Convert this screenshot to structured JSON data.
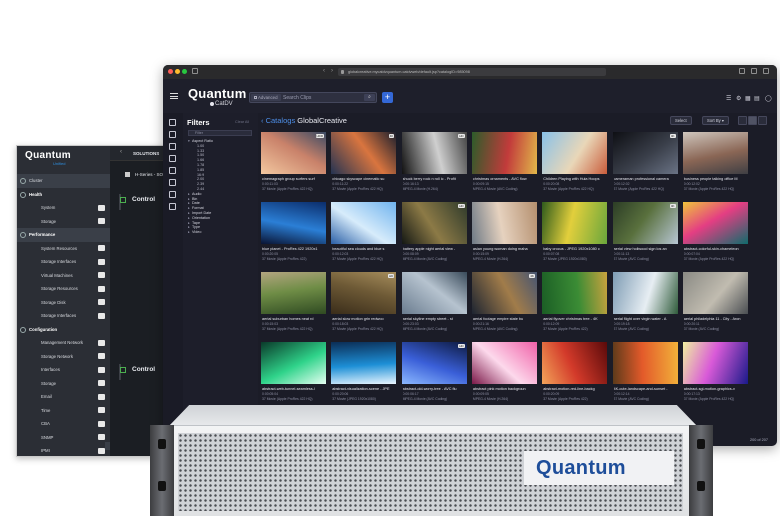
{
  "management": {
    "logo": "Quantum",
    "sublogo": "Unified",
    "nav": [
      {
        "label": "Cluster",
        "kind": "item",
        "active": true
      },
      {
        "label": "Health",
        "kind": "section"
      },
      {
        "label": "System",
        "kind": "sub"
      },
      {
        "label": "Storage",
        "kind": "sub"
      },
      {
        "label": "Performance",
        "kind": "section",
        "active": true
      },
      {
        "label": "System Resources",
        "kind": "sub"
      },
      {
        "label": "Storage Interfaces",
        "kind": "sub"
      },
      {
        "label": "Virtual Machines",
        "kind": "sub"
      },
      {
        "label": "Storage Resources",
        "kind": "sub"
      },
      {
        "label": "Storage Disk",
        "kind": "sub"
      },
      {
        "label": "Storage Interfaces",
        "kind": "sub"
      },
      {
        "label": "Configuration",
        "kind": "section"
      },
      {
        "label": "Management Network",
        "kind": "sub"
      },
      {
        "label": "Storage Network",
        "kind": "sub"
      },
      {
        "label": "Interfaces",
        "kind": "sub"
      },
      {
        "label": "Storage",
        "kind": "sub"
      },
      {
        "label": "Email",
        "kind": "sub"
      },
      {
        "label": "Time",
        "kind": "sub"
      },
      {
        "label": "CBA",
        "kind": "sub"
      },
      {
        "label": "SNMP",
        "kind": "sub"
      },
      {
        "label": "IPMI",
        "kind": "sub"
      }
    ],
    "bar_title": "SOLUTIONS",
    "series_label": "H-Series - SOL",
    "controls": [
      "Control",
      "Control"
    ]
  },
  "browser": {
    "url": "globalcreative.mycatdvquantum.catdvweb/default.jsp?catalogID=985098",
    "colors": {
      "close": "#ff5f57",
      "min": "#febc2e",
      "max": "#28c840"
    }
  },
  "catdv": {
    "logo": "Quantum",
    "logo_sub": "CatDV",
    "search": {
      "advanced_label": "Advanced",
      "placeholder": "Search Clips",
      "button": "⌕"
    },
    "add_label": "+",
    "filters": {
      "title": "Filters",
      "clear": "Clear All",
      "input_placeholder": "Filter",
      "tree": [
        {
          "label": "Aspect Ratio",
          "level": 1,
          "open": true
        },
        {
          "label": "1.00",
          "level": 2
        },
        {
          "label": "1.33",
          "level": 2
        },
        {
          "label": "1.50",
          "level": 2
        },
        {
          "label": "1.66",
          "level": 2
        },
        {
          "label": "1.78",
          "level": 2
        },
        {
          "label": "1.85",
          "level": 2
        },
        {
          "label": "16:9",
          "level": 2
        },
        {
          "label": "2.00",
          "level": 2
        },
        {
          "label": "2.39",
          "level": 2
        },
        {
          "label": "2.44",
          "level": 2
        },
        {
          "label": "Audio",
          "level": 1
        },
        {
          "label": "Bin",
          "level": 1
        },
        {
          "label": "Date",
          "level": 1
        },
        {
          "label": "Format",
          "level": 1
        },
        {
          "label": "Import Date",
          "level": 1
        },
        {
          "label": "Orientation",
          "level": 1
        },
        {
          "label": "Tape",
          "level": 1
        },
        {
          "label": "Type",
          "level": 1
        },
        {
          "label": "Video",
          "level": 1
        }
      ]
    },
    "catalog": {
      "prefix": "Catalogs",
      "name": "GlobalCreative"
    },
    "toolbar": {
      "select_label": "Select",
      "sort_label": "Sort By"
    },
    "footer": "200 of 207",
    "clips": [
      {
        "title": "cinemagraph group surfers surf",
        "dur": "0:00:11:03",
        "fmt": "37 Movie (Apple ProRes 422 HQ)",
        "colors": [
          "#f3c8a0",
          "#c9826a",
          "#3a4a63"
        ],
        "badge": "HDR"
      },
      {
        "title": "chicago skyscape cinematic su",
        "dur": "0:00:11:22",
        "fmt": "37 Movie (Apple ProRes 422 HQ)",
        "colors": [
          "#243352",
          "#d9753f",
          "#1b1f2d"
        ],
        "badge": "4K"
      },
      {
        "title": "shuck berry rock n roll ic - Profit",
        "dur": "0:00:16:13",
        "fmt": "MPEG-4 Movie (H.264)",
        "colors": [
          "#111111",
          "#cfcfcf",
          "#444444"
        ],
        "badge": "HD"
      },
      {
        "title": "christmas ornaments - AVC flow",
        "dur": "0:00:09:15",
        "fmt": "MPEG-4 Movie (AVC Coding)",
        "colors": [
          "#2c5c2a",
          "#c23b3b",
          "#e1b84a"
        ],
        "badge": ""
      },
      {
        "title": "Children Playing with Hula Hoops",
        "dur": "0:00:20:08",
        "fmt": "37 Movie (Apple ProRes 422 HQ)",
        "colors": [
          "#89c1e8",
          "#e9d7b8",
          "#c95c3b"
        ],
        "badge": ""
      },
      {
        "title": "cameraman professional camera",
        "dur": "0:00:12:02",
        "fmt": "37 Movie (Apple ProRes 422 HQ)",
        "colors": [
          "#0e0f14",
          "#3a3f4a",
          "#6a7385"
        ],
        "badge": "4K"
      },
      {
        "title": "business people talking office M",
        "dur": "0:00:12:02",
        "fmt": "37 Movie (Apple ProRes 422 HQ)",
        "colors": [
          "#cfc6bd",
          "#8a6655",
          "#3f3f44"
        ],
        "badge": ""
      },
      {
        "title": "blue planet - ProRes 422 1920x1",
        "dur": "0:00:20:05",
        "fmt": "37 Movie (Apple ProRes 422)",
        "colors": [
          "#0b2d6b",
          "#2b7fd6",
          "#0a1433"
        ],
        "badge": ""
      },
      {
        "title": "beautiful sea clouds and blue s",
        "dur": "0:00:12:03",
        "fmt": "37 Movie (Apple ProRes 422 HQ)",
        "colors": [
          "#6fb3ee",
          "#d7ecfb",
          "#2a5fa6"
        ],
        "badge": ""
      },
      {
        "title": "battery apple night aerial view -",
        "dur": "0:00:08:09",
        "fmt": "MPEG-4 Movie (AVC Coding)",
        "colors": [
          "#2e3a2b",
          "#8c7a46",
          "#141814"
        ],
        "badge": "HD"
      },
      {
        "title": "asian young woman doing maha",
        "dur": "0:00:15:09",
        "fmt": "MPEG-4 Movie (H.264)",
        "colors": [
          "#b48f6e",
          "#e6d2bf",
          "#6f7a86"
        ],
        "badge": ""
      },
      {
        "title": "baby crocus - JPEG 1920x1080 c",
        "dur": "0:00:07:08",
        "fmt": "37 Movie (JPEG 1920x1080)",
        "colors": [
          "#6aa63c",
          "#e2cf3c",
          "#2e5a1c"
        ],
        "badge": ""
      },
      {
        "title": "aerial view holiwood sign los an",
        "dur": "0:00:11:13",
        "fmt": "37 Movie (AVC Coding)",
        "colors": [
          "#b7c6d3",
          "#59703d",
          "#2c3d26"
        ],
        "badge": "4K"
      },
      {
        "title": "abstract-colorful-skin-chameleon",
        "dur": "0:00:07:04",
        "fmt": "37 Movie (Apple ProRes 422 HQ)",
        "colors": [
          "#0f6c6c",
          "#e43e83",
          "#f0c43b"
        ],
        "badge": ""
      },
      {
        "title": "aerial suburban homes neat rd",
        "dur": "0:00:15:03",
        "fmt": "37 Movie (Apple ProRes 422 HQ)",
        "colors": [
          "#2f4a22",
          "#6f8d46",
          "#b3a580"
        ],
        "badge": ""
      },
      {
        "title": "aerial slow motion grin redwoo",
        "dur": "0:00:18:03",
        "fmt": "37 Movie (Apple ProRes 422 HQ)",
        "colors": [
          "#3a2d1a",
          "#6e5a36",
          "#a68d5c"
        ],
        "badge": "HD"
      },
      {
        "title": "aerial skyline empty street - st",
        "dur": "0:00:23:03",
        "fmt": "MPEG-4 Movie (AVC Coding)",
        "colors": [
          "#6a7c8f",
          "#b6c3cf",
          "#394a5a"
        ],
        "badge": ""
      },
      {
        "title": "aerial footage empire state bu",
        "dur": "0:00:21:16",
        "fmt": "MPEG-4 Movie (AVC Coding)",
        "colors": [
          "#1d2431",
          "#a17c4a",
          "#465572"
        ],
        "badge": "4K"
      },
      {
        "title": "aerial flyover christmas tree - 4K",
        "dur": "0:00:12:09",
        "fmt": "37 Movie (Apple ProRes 422)",
        "colors": [
          "#1b5e25",
          "#3b8c35",
          "#c9a23e"
        ],
        "badge": ""
      },
      {
        "title": "aerial flight over virgin water - A",
        "dur": "0:00:19:18",
        "fmt": "37 Movie (AVC Coding)",
        "colors": [
          "#7e9cb4",
          "#e7eef3",
          "#2f5b3a"
        ],
        "badge": ""
      },
      {
        "title": "aerial philadelphia 11 - City - Aron",
        "dur": "0:00:20:11",
        "fmt": "37 Movie (AVC Coding)",
        "colors": [
          "#8a8a84",
          "#c1bcb0",
          "#4a4e52"
        ],
        "badge": ""
      },
      {
        "title": "abstract-web-tunnel-seamless-l",
        "dur": "0:00:05:04",
        "fmt": "37 Movie (Apple ProRes 422 HQ)",
        "colors": [
          "#0a3a2a",
          "#2fd38a",
          "#e6fff2"
        ],
        "badge": ""
      },
      {
        "title": "abstract-visualization-scene - JPE",
        "dur": "0:00:20:06",
        "fmt": "37 Movie (JPEG 1920x1080)",
        "colors": [
          "#0b2d55",
          "#1d8fd6",
          "#eaf6ff"
        ],
        "badge": ""
      },
      {
        "title": "abstract-old-worry-tree - AVC flu",
        "dur": "0:00:06:17",
        "fmt": "MPEG-4 Movie (AVC Coding)",
        "colors": [
          "#0d1a40",
          "#3a5fd8",
          "#8bb8ff"
        ],
        "badge": "HD"
      },
      {
        "title": "abstract pink motion backgroun",
        "dur": "0:00:09:05",
        "fmt": "MPEG-4 Movie (H.264)",
        "colors": [
          "#f060a8",
          "#fdd9ec",
          "#7a1848"
        ],
        "badge": ""
      },
      {
        "title": "abstract-motion-red-line-backg",
        "dur": "0:00:20:09",
        "fmt": "37 Movie (Apple ProRes 422)",
        "colors": [
          "#5a0a0a",
          "#d33a2a",
          "#f3a45a"
        ],
        "badge": ""
      },
      {
        "title": "4K-cute-landscape-and-sunset -",
        "dur": "0:00:12:14",
        "fmt": "37 Movie (AVC Coding)",
        "colors": [
          "#f2b23a",
          "#e35a2a",
          "#5c3a1a"
        ],
        "badge": ""
      },
      {
        "title": "abstract-sgi-motion-graphics-v",
        "dur": "0:00:17:13",
        "fmt": "37 Movie (Apple ProRes 422 HQ)",
        "colors": [
          "#1a1a8a",
          "#d95ad8",
          "#f0f0a0"
        ],
        "badge": ""
      }
    ]
  },
  "server": {
    "brand": "Quantum",
    "colors": {
      "brand": "#1e4e9a"
    }
  }
}
